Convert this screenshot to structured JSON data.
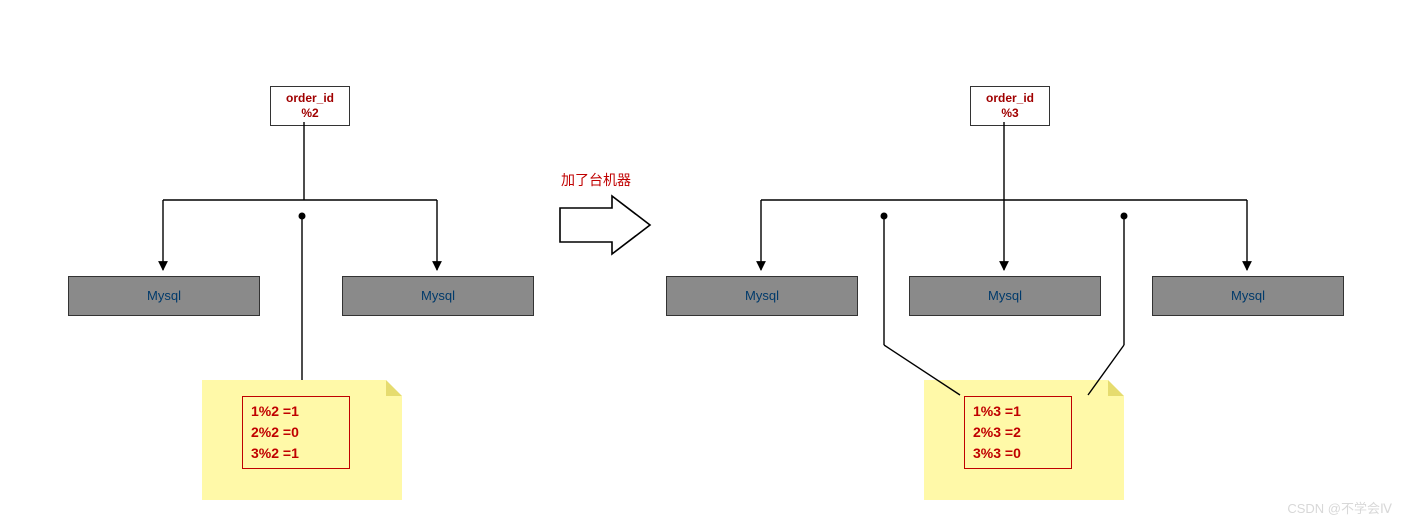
{
  "left": {
    "order_box": {
      "line1": "order_id",
      "line2": "%2"
    },
    "db": [
      "Mysql",
      "Mysql"
    ],
    "note": [
      "1%2 =1",
      "2%2 =0",
      "3%2 =1"
    ]
  },
  "transition_label": "加了台机器",
  "right": {
    "order_box": {
      "line1": "order_id",
      "line2": "%3"
    },
    "db": [
      "Mysql",
      "Mysql",
      "Mysql"
    ],
    "note": [
      "1%3 =1",
      "2%3 =2",
      "3%3 =0"
    ]
  },
  "watermark": "CSDN @不学会Ⅳ"
}
